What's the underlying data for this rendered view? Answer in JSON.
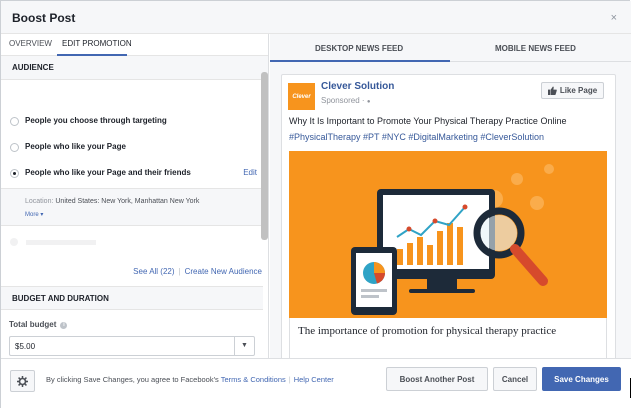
{
  "dialog": {
    "title": "Boost Post",
    "close_glyph": "×"
  },
  "left_tabs": {
    "overview": "OVERVIEW",
    "edit_promotion": "EDIT PROMOTION"
  },
  "audience": {
    "heading": "AUDIENCE",
    "options": [
      {
        "label": "People you choose through targeting",
        "checked": false
      },
      {
        "label": "People who like your Page",
        "checked": false
      },
      {
        "label": "People who like your Page and their friends",
        "checked": true
      }
    ],
    "edit_link": "Edit",
    "location_label": "Location:",
    "location_value": "United States: New York, Manhattan New York",
    "more_link": "More ▾",
    "see_all": "See All (22)",
    "create_new": "Create New Audience"
  },
  "budget": {
    "heading": "BUDGET AND DURATION",
    "total_label": "Total budget",
    "info_glyph": "i",
    "value": "$5.00",
    "arrow_glyph": "▼"
  },
  "preview_tabs": {
    "desktop": "DESKTOP NEWS FEED",
    "mobile": "MOBILE NEWS FEED"
  },
  "post": {
    "page_name": "Clever Solution",
    "avatar_text": "Clever",
    "sponsored": "Sponsored · ",
    "globe_glyph": "🌐",
    "like_label": "Like Page",
    "text": "Why It Is Important to Promote Your Physical Therapy Practice Online",
    "hashtags": "#PhysicalTherapy #PT #NYC #DigitalMarketing #CleverSolution",
    "link_title": "The importance of promotion for physical therapy practice",
    "accent_color": "#f7941d"
  },
  "footer": {
    "agree_text": "By clicking Save Changes, you agree to Facebook's",
    "terms_link": "Terms & Conditions",
    "help_link": "Help Center",
    "boost_another": "Boost Another Post",
    "cancel": "Cancel",
    "save": "Save Changes",
    "primary_color": "#4267b2"
  }
}
